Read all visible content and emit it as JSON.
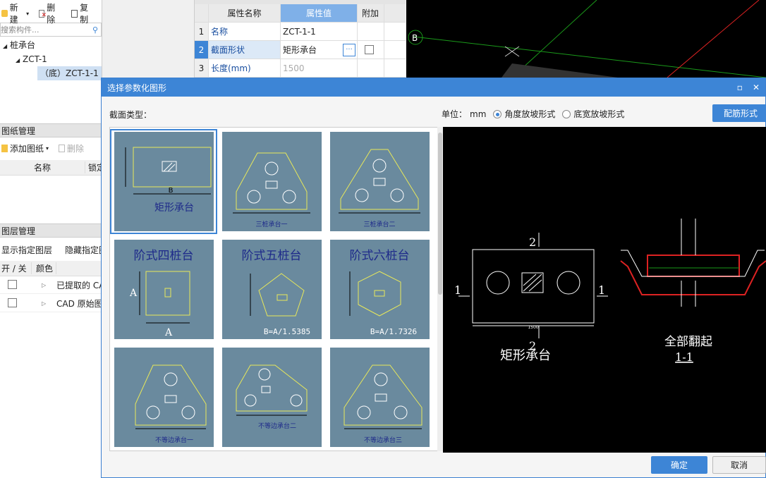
{
  "left": {
    "toolbar": {
      "new": "新建",
      "delete": "删除",
      "copy": "复制"
    },
    "search_placeholder": "搜索构件...",
    "tree": {
      "root": "桩承台",
      "child": "ZCT-1",
      "leaf": "（底）ZCT-1-1"
    },
    "drawings": {
      "title": "图纸管理",
      "add": "添加图纸",
      "delete": "删除",
      "col_name": "名称",
      "col_lock": "锁定"
    },
    "layers": {
      "title": "图层管理",
      "show": "显示指定图层",
      "hide": "隐藏指定图层",
      "col_toggle": "开 / 关",
      "col_color": "颜色",
      "rows": [
        "已提取的 CAD 图层",
        "CAD 原始图层"
      ]
    }
  },
  "props": {
    "headers": [
      "属性名称",
      "属性值",
      "附加"
    ],
    "rows": [
      {
        "num": "1",
        "name": "名称",
        "value": "ZCT-1-1"
      },
      {
        "num": "2",
        "name": "截面形状",
        "value": "矩形承台"
      },
      {
        "num": "3",
        "name": "长度(mm)",
        "value": "1500"
      }
    ]
  },
  "cad_top": {
    "marker": "B"
  },
  "dialog": {
    "title": "选择参数化图形",
    "section_type_label": "截面类型：",
    "unit_label": "单位：",
    "unit_value": "mm",
    "radio1": "角度放坡形式",
    "radio2": "底宽放坡形式",
    "rebar_button": "配筋形式",
    "ok": "确定",
    "cancel": "取消",
    "thumbs": [
      {
        "label": "矩形承台",
        "dim": "B"
      },
      {
        "label": "三桩承台一"
      },
      {
        "label": "三桩承台二"
      },
      {
        "label": "阶式四桩台",
        "dim": "A"
      },
      {
        "label": "阶式五桩台",
        "formula": "B=A/1.5385"
      },
      {
        "label": "阶式六桩台",
        "formula": "B=A/1.7326"
      },
      {
        "label": "不等边承台一"
      },
      {
        "label": "不等边承台二"
      },
      {
        "label": "不等边承台三"
      }
    ],
    "preview": {
      "shape_name": "矩形承台",
      "section_mark": "2",
      "section_side": "1",
      "dim": "1500",
      "right_title": "全部翻起",
      "right_sub": "1-1"
    }
  }
}
